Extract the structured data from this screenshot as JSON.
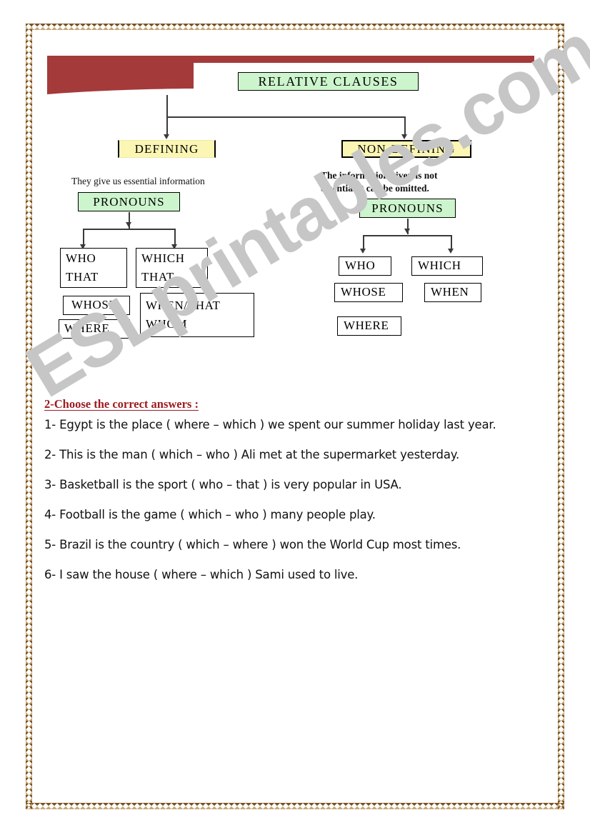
{
  "watermark": {
    "text": "ESLprintables.com",
    "color": "#c6c6c6"
  },
  "banner": {
    "color": "#a53a3a"
  },
  "diagram": {
    "title": "RELATIVE CLAUSES",
    "title_color": "#cdf5cd",
    "branches": [
      {
        "label": "DEFINING",
        "label_color": "#fbf6b4",
        "caption": "They give us essential information",
        "pronouns_label": "PRONOUNS",
        "pronouns_color": "#cdf5cd",
        "boxes": [
          {
            "name": "who-that-box",
            "lines": [
              "WHO",
              "THAT"
            ]
          },
          {
            "name": "which-that-box",
            "lines": [
              "WHICH",
              "THAT"
            ]
          },
          {
            "name": "whose-box",
            "lines": [
              "WHOSE"
            ]
          },
          {
            "name": "when-that-whom-box",
            "lines": [
              "WHEN/THAT",
              "WHOM"
            ]
          },
          {
            "name": "where-box",
            "lines": [
              "WHERE"
            ]
          }
        ]
      },
      {
        "label": "NON-DEFINING",
        "label_color": "#fbf6b4",
        "caption_line1": "The information given is not",
        "caption_line2": "essential,it can be omitted.",
        "pronouns_label": "PRONOUNS",
        "pronouns_color": "#cdf5cd",
        "boxes": [
          {
            "name": "who-box",
            "lines": [
              "WHO"
            ]
          },
          {
            "name": "which-box",
            "lines": [
              "WHICH"
            ]
          },
          {
            "name": "whose-box",
            "lines": [
              "WHOSE"
            ]
          },
          {
            "name": "when-box",
            "lines": [
              "WHEN"
            ]
          },
          {
            "name": "where-box",
            "lines": [
              "WHERE"
            ]
          }
        ]
      }
    ]
  },
  "exercise": {
    "heading": "2-Choose the correct answers :",
    "heading_color": "#9e1b22",
    "questions": [
      "1- Egypt is the place ( where – which ) we spent our summer holiday last year.",
      "2-  This is the man ( which – who ) Ali met at the supermarket yesterday.",
      "3- Basketball is the sport ( who – that ) is very popular in USA.",
      "4- Football is the game ( which – who ) many people play.",
      "5- Brazil is the country ( which – where ) won the World Cup most times.",
      "6- I saw the house ( where – which ) Sami used to live."
    ]
  }
}
